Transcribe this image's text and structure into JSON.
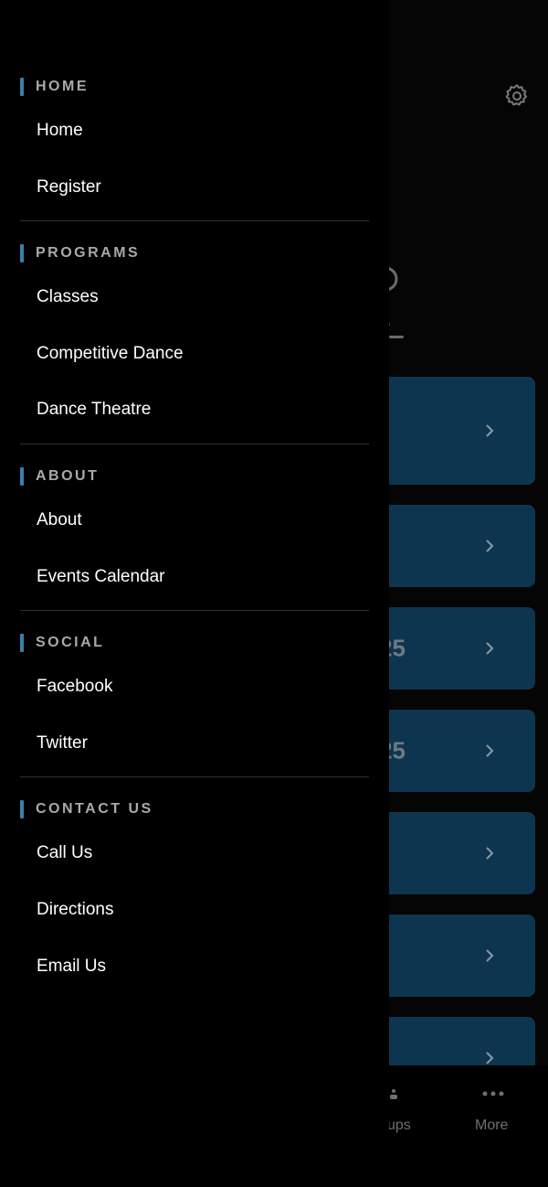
{
  "background_app": {
    "partial_link_text": "e",
    "card_numbers": [
      "25",
      "25"
    ],
    "tabbar": {
      "groups_label_fragment": "ups",
      "more_label": "More"
    }
  },
  "drawer": {
    "sections": [
      {
        "title": "HOME",
        "items": [
          "Home",
          "Register"
        ]
      },
      {
        "title": "PROGRAMS",
        "items": [
          "Classes",
          "Competitive Dance",
          "Dance Theatre"
        ]
      },
      {
        "title": "ABOUT",
        "items": [
          "About",
          "Events Calendar"
        ]
      },
      {
        "title": "SOCIAL",
        "items": [
          "Facebook",
          "Twitter"
        ]
      },
      {
        "title": "CONTACT US",
        "items": [
          "Call Us",
          "Directions",
          "Email Us"
        ]
      }
    ]
  },
  "colors": {
    "accent_bar": "#3a7fa8",
    "card_bg": "#0d3550",
    "section_title": "#a9a9a9"
  }
}
